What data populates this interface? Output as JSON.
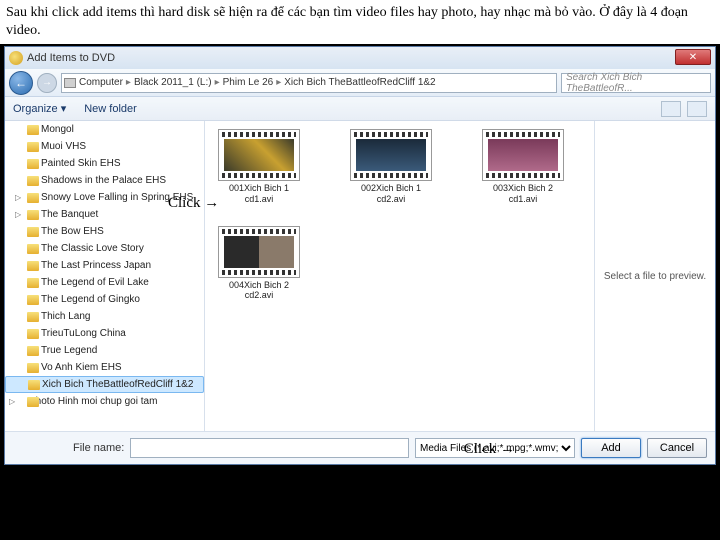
{
  "instruction": "Sau khi click add items thì hard disk sẽ hiện ra để các bạn tìm video files hay photo, hay nhạc mà bỏ vào. Ở đây là 4 đoạn video.",
  "dialog": {
    "title": "Add Items to DVD",
    "close": "✕"
  },
  "nav": {
    "back": "←",
    "fwd": "→",
    "crumbs": [
      "Computer",
      "Black 2011_1 (L:)",
      "Phim Le 26",
      "Xich Bich TheBattleofRedCliff 1&2"
    ],
    "search_placeholder": "Search Xich Bich TheBattleofR..."
  },
  "toolbar": {
    "organize": "Organize ▾",
    "newfolder": "New folder"
  },
  "folders": [
    {
      "label": "Mongol"
    },
    {
      "label": "Muoi VHS"
    },
    {
      "label": "Painted Skin EHS"
    },
    {
      "label": "Shadows in the Palace EHS"
    },
    {
      "label": "Snowy Love Falling in Spring EHS",
      "tri": "▷"
    },
    {
      "label": "The Banquet",
      "tri": "▷"
    },
    {
      "label": "The Bow EHS"
    },
    {
      "label": "The Classic Love Story"
    },
    {
      "label": "The Last Princess Japan"
    },
    {
      "label": "The Legend of Evil Lake"
    },
    {
      "label": "The Legend of Gingko"
    },
    {
      "label": "Thich Lang"
    },
    {
      "label": "TrieuTuLong China"
    },
    {
      "label": "True Legend"
    },
    {
      "label": "Vo Anh Kiem EHS"
    },
    {
      "label": "Xich Bich TheBattleofRedCliff 1&2",
      "sel": true
    }
  ],
  "lastnode": "Photo Hinh moi chup goi tam",
  "files": [
    {
      "name": "001Xich Bich 1",
      "sub": "cd1.avi",
      "thumb": "thumb1"
    },
    {
      "name": "002Xich Bich 1",
      "sub": "cd2.avi",
      "thumb": "thumb2"
    },
    {
      "name": "003Xich Bich 2",
      "sub": "cd1.avi",
      "thumb": "thumb3"
    },
    {
      "name": "004Xich Bich 2",
      "sub": "cd2.avi",
      "thumb": "thumb4"
    }
  ],
  "preview": "Select a file to preview.",
  "footer": {
    "filename_label": "File name:",
    "filter": "Media Files (*.avi;*.mpg;*.wmv;*...)",
    "add": "Add",
    "cancel": "Cancel"
  },
  "annot": {
    "click1": "Click →",
    "click2": "Click →"
  }
}
